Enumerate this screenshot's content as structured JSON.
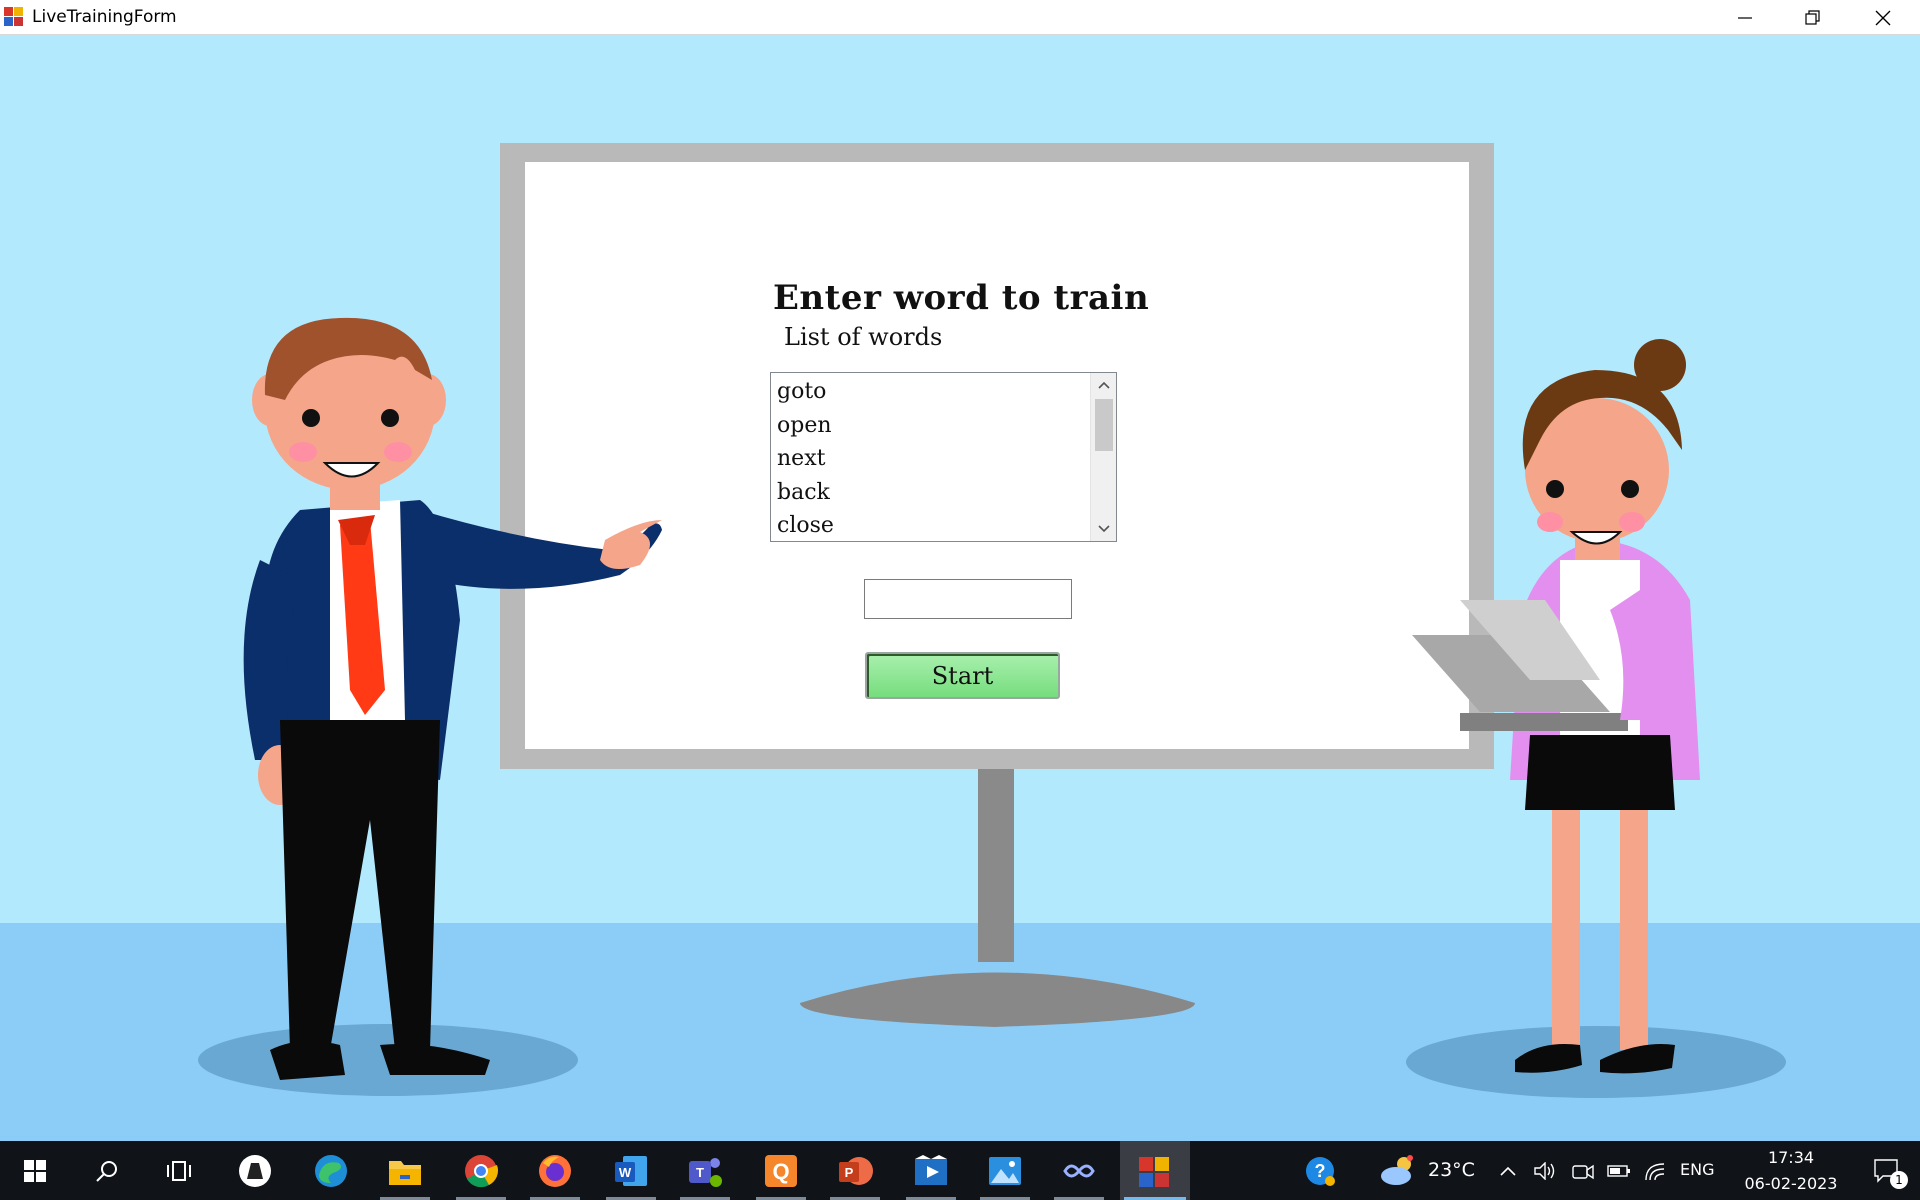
{
  "window": {
    "title": "LiveTrainingForm"
  },
  "form": {
    "heading": "Enter word to train",
    "list_label": "List of words",
    "words": [
      "goto",
      "open",
      "next",
      "back",
      "close"
    ],
    "word_input_value": "",
    "start_label": "Start"
  },
  "taskbar": {
    "apps": [
      "start-icon",
      "search-icon",
      "task-view-icon",
      "app-icon",
      "edge-icon",
      "file-explorer-icon",
      "chrome-icon",
      "firefox-icon",
      "word-icon",
      "teams-icon",
      "q-app-icon",
      "powerpoint-icon",
      "video-editor-icon",
      "photos-icon",
      "infinity-app-icon",
      "live-training-form-icon"
    ],
    "weather_temp": "23°C",
    "language": "ENG",
    "time": "17:34",
    "date": "06-02-2023",
    "notification_count": "1"
  },
  "colors": {
    "sky": "#b3e9fd",
    "floor": "#8ccdf7",
    "taskbar": "#101318",
    "start_button_green": "#76dd7d"
  }
}
